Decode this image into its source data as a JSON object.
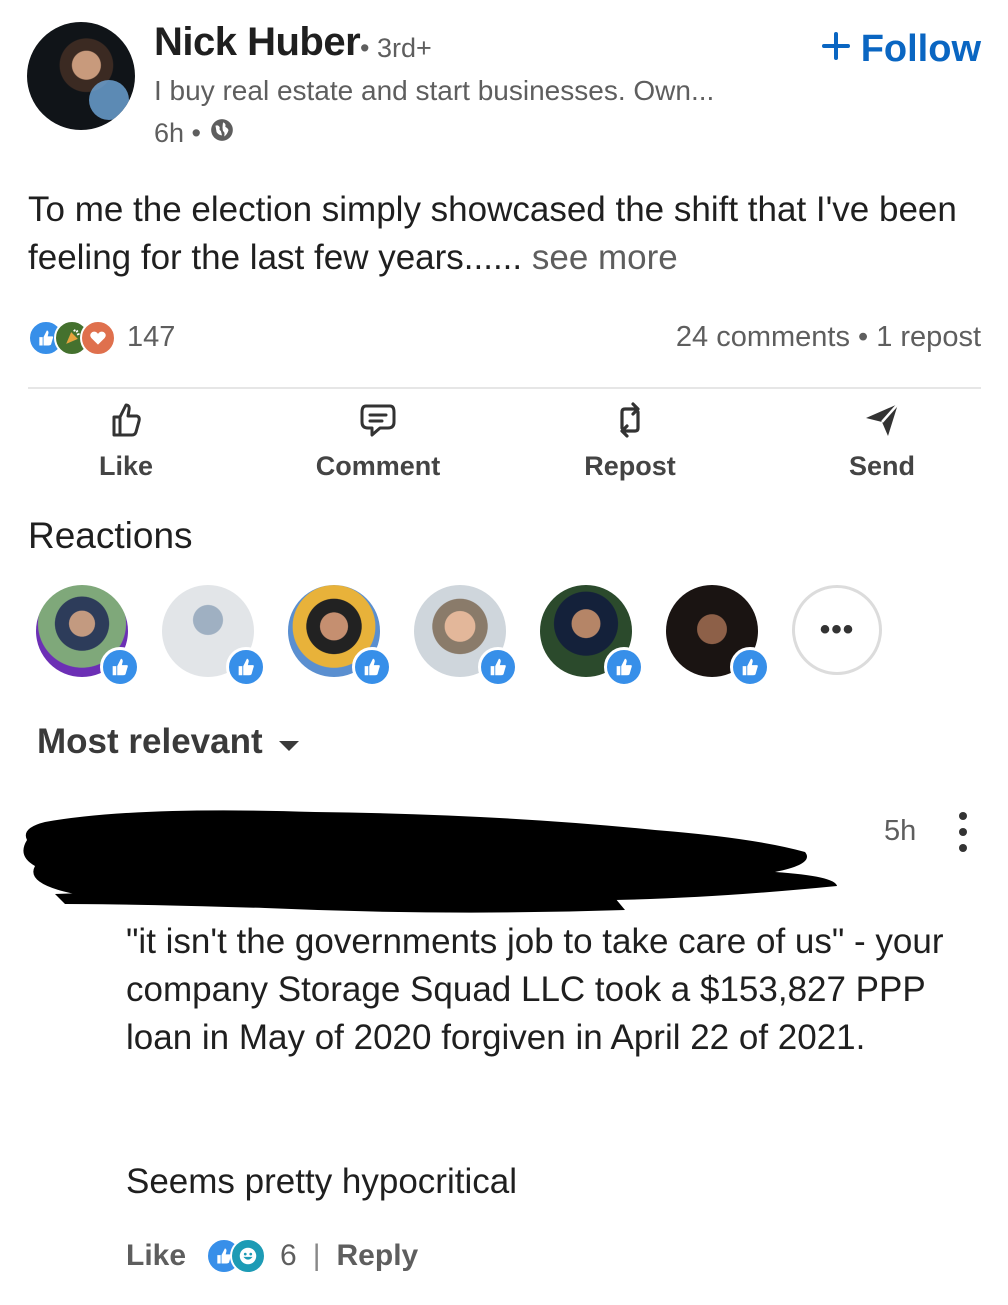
{
  "post": {
    "author_name": "Nick Huber",
    "degree": "• 3rd+",
    "headline": "I buy real estate and start businesses. Own...",
    "time": "6h •",
    "follow_label": "Follow",
    "text": "To me the election simply showcased the shift that I've been feeling for the last few years......",
    "see_more": "see more"
  },
  "social": {
    "reaction_count": "147",
    "comments_reposts": "24 comments • 1 repost",
    "reaction_icons": [
      "like-icon",
      "celebrate-icon",
      "love-icon"
    ]
  },
  "actions": [
    {
      "label": "Like",
      "icon": "thumbs-up-icon"
    },
    {
      "label": "Comment",
      "icon": "comment-icon"
    },
    {
      "label": "Repost",
      "icon": "repost-icon"
    },
    {
      "label": "Send",
      "icon": "send-icon"
    }
  ],
  "reactions": {
    "title": "Reactions",
    "more_label": "•••"
  },
  "sort": {
    "label": "Most relevant"
  },
  "comment": {
    "time": "5h",
    "text": "\"it isn't the governments job to take care of us\" - your company Storage Squad LLC took a $153,827 PPP loan in May of 2020 forgiven in April 22 of 2021.",
    "text2": "Seems pretty hypocritical",
    "like_label": "Like",
    "reaction_count": "6",
    "separator": "|",
    "reply_label": "Reply"
  },
  "colors": {
    "accent": "#0a66c2",
    "like_blue": "#378fe9",
    "celebrate_green": "#44712e",
    "love_red": "#df704d",
    "funny_teal": "#1d9bb5"
  }
}
